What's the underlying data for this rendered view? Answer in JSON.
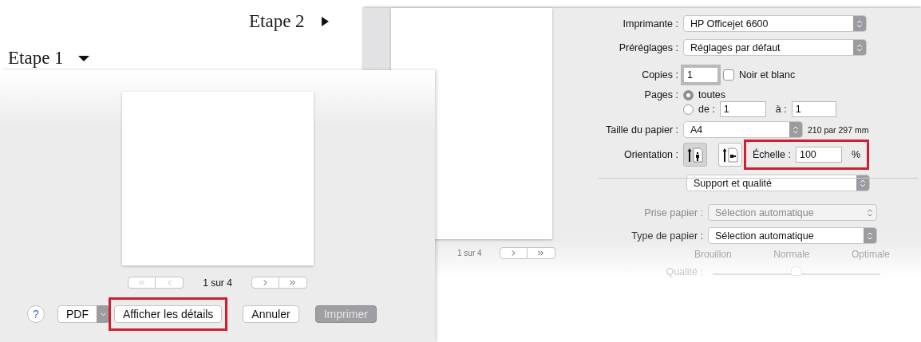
{
  "steps": [
    {
      "label": "Etape 2",
      "kind": "right"
    },
    {
      "label": "Etape 1",
      "kind": "down"
    }
  ],
  "details_dialog": {
    "page_counter": "1 sur 4",
    "fields": [
      {
        "kind": "select",
        "label": "Imprimante :",
        "value": "HP Officejet 6600"
      },
      {
        "kind": "select",
        "label": "Préréglages :",
        "value": "Réglages par défaut"
      },
      {
        "kind": "copies",
        "label": "Copies :",
        "value": "1",
        "option": {
          "label": "Noir et blanc",
          "checked": false
        }
      },
      {
        "kind": "pages",
        "label": "Pages :",
        "options": [
          {
            "label": "toutes",
            "selected": true
          },
          {
            "label": "de :",
            "selected": false,
            "from": "1",
            "to_label": "à :",
            "to": "1"
          }
        ]
      },
      {
        "kind": "paper",
        "label": "Taille du papier :",
        "value": "A4",
        "note": "210 par 297 mm"
      },
      {
        "kind": "orientation",
        "label": "Orientation :",
        "options": [
          {
            "kind": "portrait",
            "selected": true
          },
          {
            "kind": "landscape",
            "selected": false
          }
        ],
        "scale": {
          "label": "Échelle :",
          "value": "100",
          "unit": "%",
          "highlighted": true
        }
      }
    ],
    "section": "Support et qualité",
    "quality_fields": [
      {
        "label": "Prise papier :",
        "value": "Sélection automatique",
        "disabled": true
      },
      {
        "label": "Type de papier :",
        "value": "Sélection automatique",
        "disabled": false
      }
    ],
    "quality": {
      "label": "Qualité :",
      "ticks": [
        "Brouillon",
        "Normale",
        "Optimale"
      ],
      "level": 0.5,
      "disabled": true
    }
  },
  "compact_dialog": {
    "page_counter": "1 sur 4",
    "help": "?",
    "buttons": [
      {
        "kind": "menu",
        "label": "PDF",
        "highlighted": false,
        "disabled": false
      },
      {
        "kind": "push",
        "label": "Afficher les détails",
        "highlighted": true,
        "disabled": false
      },
      {
        "kind": "push",
        "label": "Annuler",
        "highlighted": false,
        "disabled": false
      },
      {
        "kind": "push",
        "label": "Imprimer",
        "highlighted": false,
        "disabled": true
      }
    ]
  }
}
